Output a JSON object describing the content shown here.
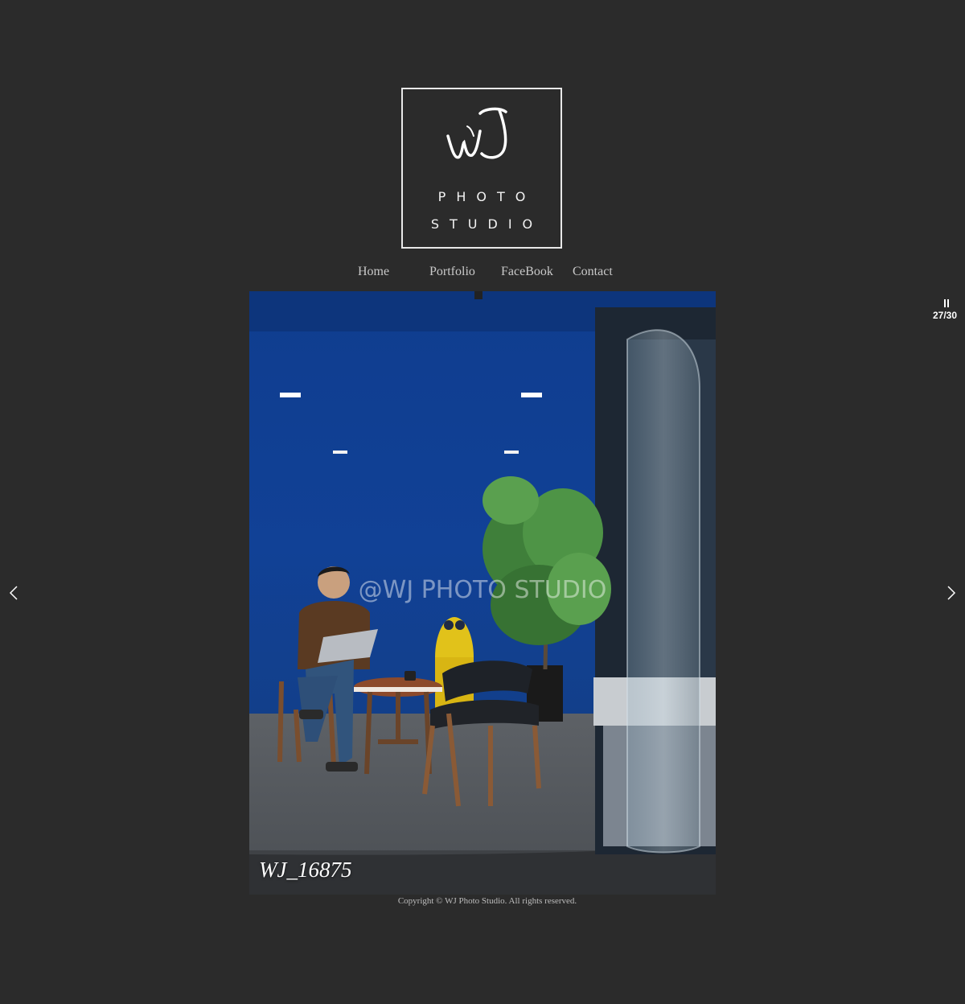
{
  "logo": {
    "mark": "WJ",
    "line1": "PHOTO",
    "line2": "STUDIO"
  },
  "nav": {
    "items": [
      {
        "label": "Home"
      },
      {
        "label": "Portfolio"
      },
      {
        "label": "FaceBook"
      },
      {
        "label": "Contact"
      }
    ]
  },
  "slideshow": {
    "watermark": "@WJ PHOTO STUDIO",
    "caption": "WJ_16875",
    "counter": "27/30",
    "pause_icon": "pause-icon",
    "prev_icon": "chevron-left-icon",
    "next_icon": "chevron-right-icon"
  },
  "footer": {
    "copyright": "Copyright © WJ Photo Studio. All rights reserved."
  },
  "colors": {
    "background": "#2b2b2b",
    "wall_blue": "#123f8c",
    "text": "#c9c9c9"
  }
}
